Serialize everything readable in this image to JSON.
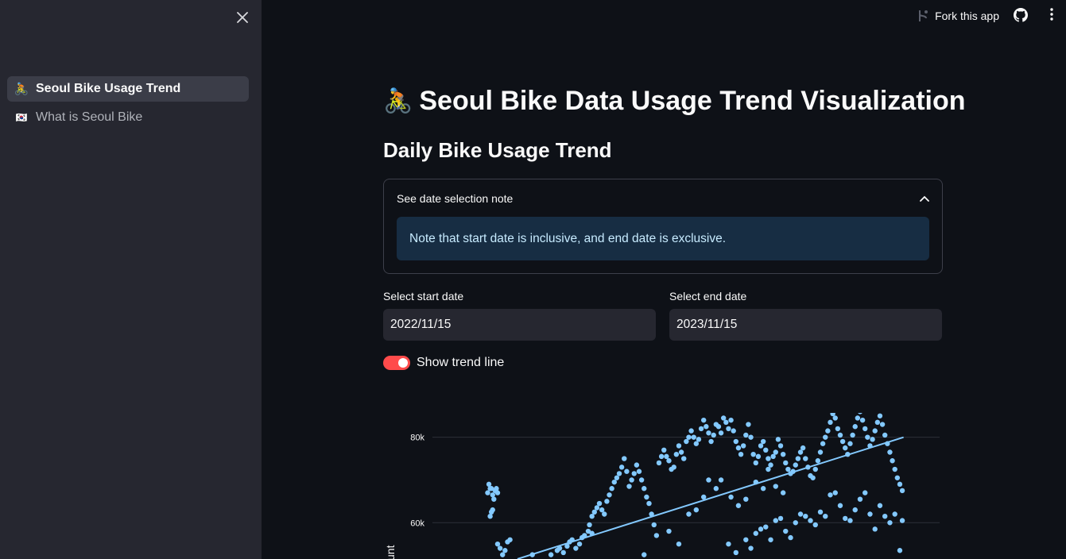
{
  "sidebar": {
    "items": [
      {
        "emoji": "🚴",
        "label": "Seoul Bike Usage Trend",
        "active": true
      },
      {
        "emoji": "🇰🇷",
        "label": "What is Seoul Bike",
        "active": false
      }
    ]
  },
  "header": {
    "fork_label": "Fork this app"
  },
  "main": {
    "title_emoji": "🚴",
    "title": "Seoul Bike Data Usage Trend Visualization",
    "subtitle": "Daily Bike Usage Trend",
    "expander": {
      "label": "See date selection note",
      "note": "Note that start date is inclusive, and end date is exclusive."
    },
    "start_date": {
      "label": "Select start date",
      "value": "2022/11/15"
    },
    "end_date": {
      "label": "Select end date",
      "value": "2023/11/15"
    },
    "toggle": {
      "label": "Show trend line",
      "checked": true
    }
  },
  "colors": {
    "accent": "#ff4b4b",
    "point": "#83c9ff",
    "info_bg": "#172d43",
    "info_text": "#c7ebff"
  },
  "chart_data": {
    "type": "scatter",
    "ylabel": "unt",
    "yticks": [
      "80k",
      "60k"
    ],
    "ytick_values": [
      80000,
      60000
    ],
    "ylim": [
      51500,
      85700
    ],
    "x_index_range": [
      0,
      365
    ],
    "trend": {
      "x": [
        48,
        359
      ],
      "y": [
        51500,
        80000
      ]
    },
    "series": [
      {
        "points": [
          [
            24,
            67000
          ],
          [
            25,
            69000
          ],
          [
            26,
            68000
          ],
          [
            27,
            68000
          ],
          [
            28,
            66500
          ],
          [
            29,
            65500
          ],
          [
            30,
            67500
          ],
          [
            31,
            68000
          ],
          [
            32,
            67000
          ],
          [
            28,
            63000
          ],
          [
            26,
            61500
          ],
          [
            27,
            62500
          ],
          [
            32,
            55000
          ],
          [
            34,
            54000
          ],
          [
            36,
            52500
          ],
          [
            38,
            53500
          ],
          [
            40,
            55500
          ],
          [
            42,
            56000
          ],
          [
            60,
            52500
          ],
          [
            75,
            52500
          ],
          [
            80,
            53500
          ],
          [
            82,
            54000
          ],
          [
            85,
            53000
          ],
          [
            88,
            54500
          ],
          [
            90,
            55500
          ],
          [
            92,
            56000
          ],
          [
            95,
            54000
          ],
          [
            98,
            55000
          ],
          [
            100,
            56500
          ],
          [
            102,
            57000
          ],
          [
            105,
            58000
          ],
          [
            108,
            57500
          ],
          [
            106,
            59500
          ],
          [
            108,
            61500
          ],
          [
            110,
            62500
          ],
          [
            112,
            63500
          ],
          [
            114,
            64500
          ],
          [
            116,
            63000
          ],
          [
            118,
            62000
          ],
          [
            120,
            65000
          ],
          [
            122,
            66500
          ],
          [
            124,
            68000
          ],
          [
            126,
            69500
          ],
          [
            128,
            70500
          ],
          [
            130,
            71500
          ],
          [
            132,
            73000
          ],
          [
            134,
            75000
          ],
          [
            136,
            72000
          ],
          [
            138,
            68500
          ],
          [
            140,
            70000
          ],
          [
            142,
            71500
          ],
          [
            144,
            73500
          ],
          [
            146,
            72000
          ],
          [
            148,
            70000
          ],
          [
            150,
            68000
          ],
          [
            152,
            66000
          ],
          [
            154,
            64500
          ],
          [
            156,
            62000
          ],
          [
            158,
            59500
          ],
          [
            160,
            57000
          ],
          [
            162,
            74000
          ],
          [
            164,
            75500
          ],
          [
            166,
            77000
          ],
          [
            168,
            75500
          ],
          [
            170,
            74500
          ],
          [
            172,
            72500
          ],
          [
            174,
            73000
          ],
          [
            176,
            76000
          ],
          [
            178,
            78000
          ],
          [
            180,
            76500
          ],
          [
            182,
            75000
          ],
          [
            184,
            79000
          ],
          [
            186,
            80000
          ],
          [
            188,
            81500
          ],
          [
            190,
            80000
          ],
          [
            192,
            78500
          ],
          [
            194,
            79500
          ],
          [
            196,
            82000
          ],
          [
            198,
            84000
          ],
          [
            200,
            82500
          ],
          [
            202,
            81000
          ],
          [
            204,
            79000
          ],
          [
            206,
            80500
          ],
          [
            208,
            83000
          ],
          [
            210,
            82500
          ],
          [
            212,
            81000
          ],
          [
            214,
            84500
          ],
          [
            216,
            83500
          ],
          [
            218,
            82000
          ],
          [
            220,
            84000
          ],
          [
            222,
            81500
          ],
          [
            224,
            79000
          ],
          [
            226,
            77500
          ],
          [
            228,
            76000
          ],
          [
            230,
            78000
          ],
          [
            232,
            80500
          ],
          [
            234,
            83000
          ],
          [
            236,
            80000
          ],
          [
            238,
            76000
          ],
          [
            240,
            74000
          ],
          [
            242,
            75500
          ],
          [
            244,
            78000
          ],
          [
            246,
            79000
          ],
          [
            248,
            77000
          ],
          [
            250,
            75000
          ],
          [
            252,
            73500
          ],
          [
            254,
            75500
          ],
          [
            256,
            76500
          ],
          [
            258,
            79500
          ],
          [
            260,
            78000
          ],
          [
            262,
            76000
          ],
          [
            264,
            74000
          ],
          [
            266,
            72500
          ],
          [
            268,
            71500
          ],
          [
            270,
            72000
          ],
          [
            272,
            73500
          ],
          [
            274,
            75000
          ],
          [
            276,
            76500
          ],
          [
            278,
            77500
          ],
          [
            280,
            75000
          ],
          [
            282,
            73000
          ],
          [
            284,
            71000
          ],
          [
            286,
            70500
          ],
          [
            288,
            72500
          ],
          [
            290,
            74500
          ],
          [
            292,
            76500
          ],
          [
            294,
            78500
          ],
          [
            296,
            80000
          ],
          [
            298,
            81500
          ],
          [
            300,
            83500
          ],
          [
            302,
            85500
          ],
          [
            304,
            84500
          ],
          [
            306,
            82000
          ],
          [
            308,
            80500
          ],
          [
            310,
            79000
          ],
          [
            312,
            77500
          ],
          [
            314,
            76000
          ],
          [
            316,
            78500
          ],
          [
            318,
            80500
          ],
          [
            320,
            82500
          ],
          [
            322,
            84500
          ],
          [
            324,
            86000
          ],
          [
            326,
            84000
          ],
          [
            328,
            82000
          ],
          [
            330,
            80000
          ],
          [
            332,
            78000
          ],
          [
            334,
            79500
          ],
          [
            336,
            81500
          ],
          [
            338,
            83500
          ],
          [
            340,
            85000
          ],
          [
            342,
            83000
          ],
          [
            344,
            80500
          ],
          [
            346,
            78500
          ],
          [
            348,
            76500
          ],
          [
            350,
            74500
          ],
          [
            352,
            72500
          ],
          [
            354,
            70500
          ],
          [
            356,
            69000
          ],
          [
            358,
            67500
          ],
          [
            218,
            55000
          ],
          [
            224,
            53000
          ],
          [
            232,
            56000
          ],
          [
            236,
            54000
          ],
          [
            240,
            57500
          ],
          [
            244,
            58500
          ],
          [
            248,
            59000
          ],
          [
            252,
            56000
          ],
          [
            256,
            60500
          ],
          [
            260,
            61000
          ],
          [
            264,
            58000
          ],
          [
            268,
            56500
          ],
          [
            272,
            60000
          ],
          [
            276,
            62000
          ],
          [
            280,
            61500
          ],
          [
            284,
            60500
          ],
          [
            288,
            59500
          ],
          [
            292,
            62500
          ],
          [
            296,
            61500
          ],
          [
            300,
            66500
          ],
          [
            304,
            67000
          ],
          [
            308,
            64000
          ],
          [
            312,
            61000
          ],
          [
            316,
            60500
          ],
          [
            320,
            63000
          ],
          [
            324,
            65500
          ],
          [
            328,
            67000
          ],
          [
            332,
            62000
          ],
          [
            336,
            58500
          ],
          [
            340,
            64000
          ],
          [
            344,
            61500
          ],
          [
            348,
            60000
          ],
          [
            352,
            62000
          ],
          [
            356,
            53500
          ],
          [
            358,
            60500
          ],
          [
            150,
            52500
          ],
          [
            170,
            58000
          ],
          [
            178,
            55000
          ],
          [
            186,
            62000
          ],
          [
            192,
            63000
          ],
          [
            198,
            66000
          ],
          [
            202,
            70000
          ],
          [
            208,
            68000
          ],
          [
            212,
            70000
          ],
          [
            220,
            66000
          ],
          [
            226,
            64000
          ],
          [
            232,
            65500
          ],
          [
            240,
            69500
          ],
          [
            246,
            68000
          ],
          [
            250,
            72500
          ],
          [
            256,
            68500
          ],
          [
            262,
            67000
          ]
        ]
      }
    ]
  }
}
